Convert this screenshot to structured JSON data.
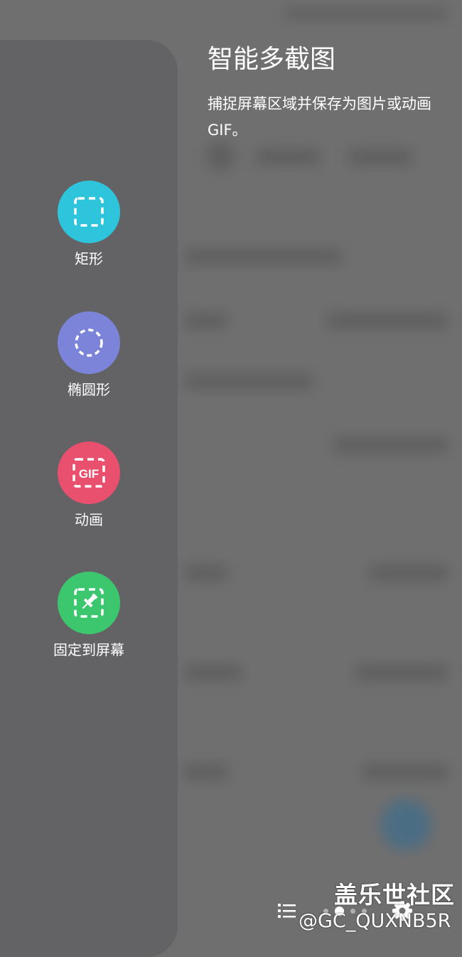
{
  "panel": {
    "tools": [
      {
        "label": "矩形",
        "color": "#2ec4dc",
        "icon": "rectangle-select-icon"
      },
      {
        "label": "椭圆形",
        "color": "#7b84d8",
        "icon": "ellipse-select-icon"
      },
      {
        "label": "动画",
        "color": "#e8506e",
        "icon": "gif-icon",
        "icon_text": "GIF"
      },
      {
        "label": "固定到屏幕",
        "color": "#3cc76e",
        "icon": "pin-to-screen-icon"
      }
    ]
  },
  "info": {
    "title": "智能多截图",
    "description": "捕捉屏幕区域并保存为图片或动画 GIF。"
  },
  "bottom": {
    "list_icon": "list-icon",
    "settings_icon": "settings-gear-icon",
    "page_count": 4,
    "active_page": 2
  },
  "watermark": {
    "line1": "盖乐世社区",
    "line2": "@GC_QUXNB5R"
  }
}
